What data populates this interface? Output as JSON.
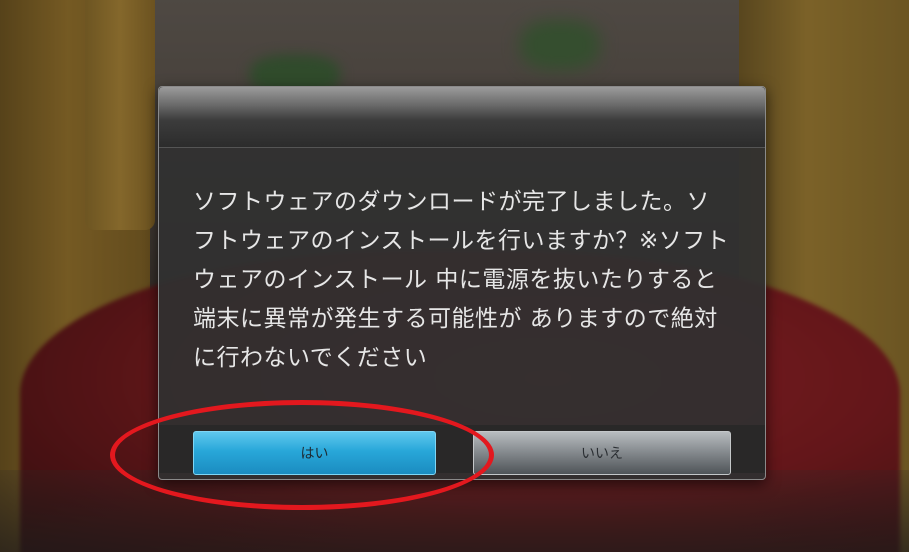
{
  "dialog": {
    "message": "ソフトウェアのダウンロードが完了しました。ソフトウェアのインストールを行いますか？※ソフトウェアのインストール 中に電源を抜いたりすると端末に異常が発生する可能性が ありますので絶対に行わないでください",
    "yes_label": "はい",
    "no_label": "いいえ"
  },
  "colors": {
    "highlight": "#e3181e",
    "yes_button": "#28a7d9"
  }
}
